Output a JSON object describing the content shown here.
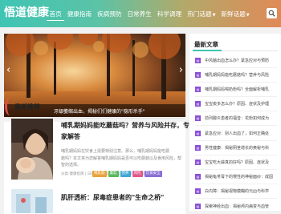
{
  "header": {
    "logo": "悟道健康",
    "nav": [
      {
        "label": "首页",
        "active": true
      },
      {
        "label": "健康指南"
      },
      {
        "label": "疾病预防"
      },
      {
        "label": "日常养生"
      },
      {
        "label": "科学调理"
      },
      {
        "label": "热门话题"
      },
      {
        "label": "新鲜话题"
      }
    ]
  },
  "slider": {
    "caption": "牙龈萎缩出血，揭秘们们健康的\"隐形杀手\""
  },
  "main": {
    "section_title": "最新推荐",
    "articles": [
      {
        "title_line1": "哺乳期妈妈能吃蘑菇吗？营养与风险并存，专",
        "title_line2": "家解答",
        "desc_line1": "哺乳期妈妈在饮食上需要特别注意。那么，哺乳期妈妈能吃蘑",
        "desc_line2": "菇吗？本文将为您解答哺乳期妈妈是否可以吃蘑菇以及食用风险，帮助您做出明",
        "desc_line3": "智的选择。",
        "meta": "分类:健康指南 | 日期:2025-10-18 16:00:01 | 浏览:3",
        "tags": [
          {
            "label": "哺乳期",
            "color": "#e8a33b"
          },
          {
            "label": "蘑菇",
            "color": "#5cb85c"
          },
          {
            "label": "营养",
            "color": "#3fa7d6"
          },
          {
            "label": "风险",
            "color": "#e05a8a"
          },
          {
            "label": "饮食安全",
            "color": "#8a6fd6"
          }
        ]
      },
      {
        "title_line1": "肌肝透析：尿毒症患者的\"生命之桥\""
      }
    ]
  },
  "sidebar": {
    "title": "最新文章",
    "items": [
      "中风脑出血怎么办？紧急应对与预防",
      "哺乳期妈妈能吃蘑菇吗？营养与风险",
      "哺乳期妈妈喝奶粉吗？全面解析哺乳",
      "宝宝痰多怎么办？原因、症状及护理",
      "前列腺炎患者的福音：花粉如何成为",
      "紧急应对：别人出血了，如何正确处",
      "男性健康：揭秘阴茎增长的奥秘与科",
      "宝宝吃大蒜真的好吗？原因、症状及",
      "揭秘龟苓膏下的慢性的神秘面纱：成因",
      "白内障：揭秘视物模糊的元凶与科学",
      "探索神经出血：揭秘颅内病变与血管"
    ]
  },
  "colors": {
    "header_start": "#3fc4b4",
    "header_end": "#e08a57",
    "accent_red": "#e84c4c",
    "sidebar_icon": "#8a4fd6"
  }
}
